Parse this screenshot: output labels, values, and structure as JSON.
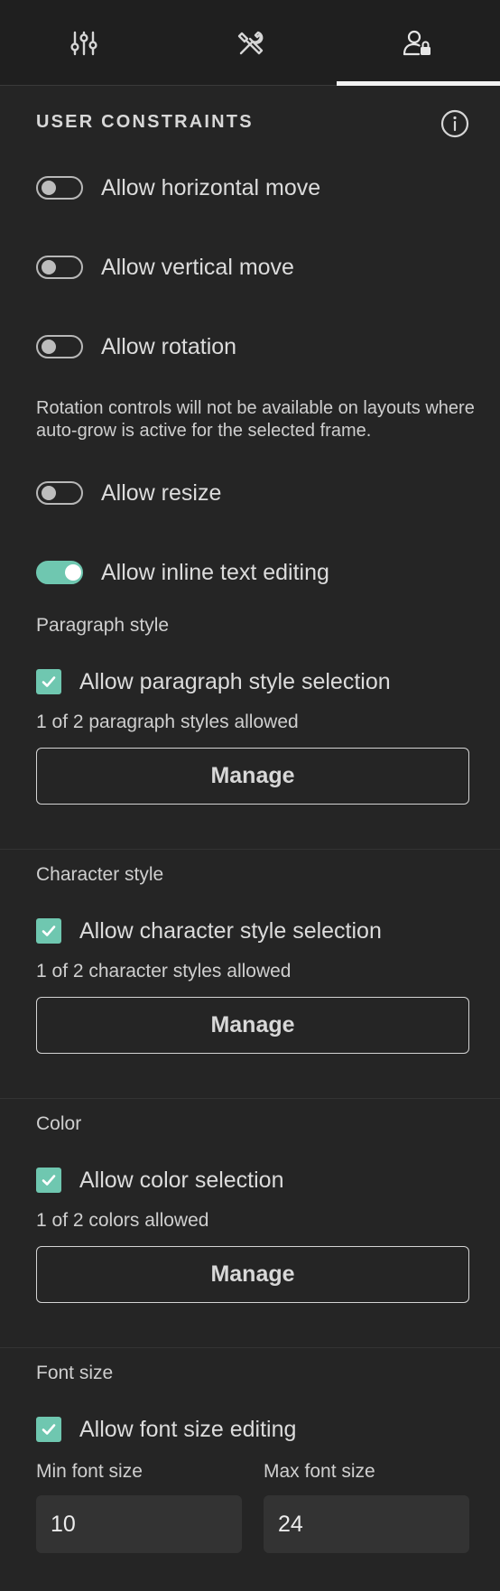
{
  "tabs": [
    {
      "icon": "sliders-icon",
      "active": false
    },
    {
      "icon": "tools-icon",
      "active": false
    },
    {
      "icon": "user-lock-icon",
      "active": true
    }
  ],
  "constraints": {
    "title": "USER CONSTRAINTS",
    "info_icon": "info-icon",
    "toggles": {
      "horizontal": {
        "label": "Allow horizontal move",
        "on": false
      },
      "vertical": {
        "label": "Allow vertical move",
        "on": false
      },
      "rotation": {
        "label": "Allow rotation",
        "on": false
      },
      "resize": {
        "label": "Allow resize",
        "on": false
      },
      "inline_text": {
        "label": "Allow inline text editing",
        "on": true
      }
    },
    "rotation_note": "Rotation controls will not be available on layouts where auto-grow is active for the selected frame."
  },
  "paragraph": {
    "label": "Paragraph style",
    "checkbox_label": "Allow paragraph style selection",
    "checked": true,
    "count": "1 of 2 paragraph styles allowed",
    "button": "Manage"
  },
  "character": {
    "label": "Character style",
    "checkbox_label": "Allow character style selection",
    "checked": true,
    "count": "1 of 2 character styles allowed",
    "button": "Manage"
  },
  "color": {
    "label": "Color",
    "checkbox_label": "Allow color selection",
    "checked": true,
    "count": "1 of 2 colors allowed",
    "button": "Manage"
  },
  "font_size": {
    "label": "Font size",
    "checkbox_label": "Allow font size editing",
    "checked": true,
    "min_label": "Min font size",
    "max_label": "Max font size",
    "min_value": "10",
    "max_value": "24"
  },
  "colors": {
    "accent": "#6fc7b0",
    "background": "#252525",
    "tabbar": "#1f1f1f",
    "input_bg": "#333333"
  }
}
